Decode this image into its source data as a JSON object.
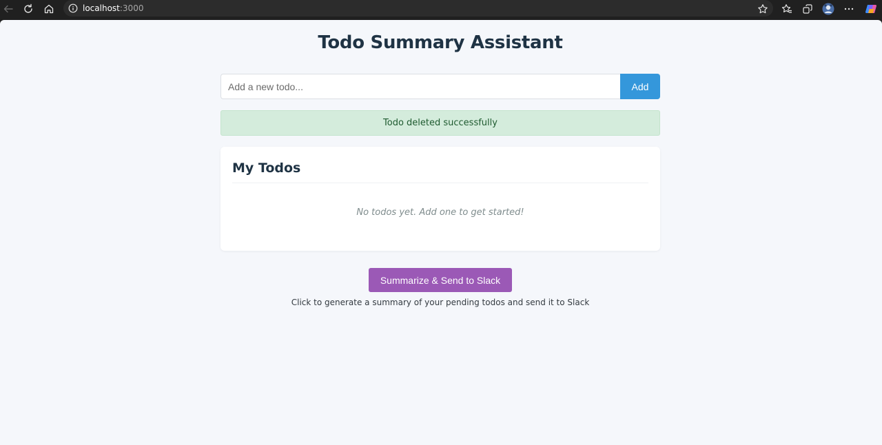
{
  "browser": {
    "url_host": "localhost",
    "url_port": ":3000",
    "icons": [
      "back-icon",
      "refresh-icon",
      "home-icon",
      "info-icon",
      "star-icon",
      "favorites-icon",
      "collections-icon",
      "profile-icon",
      "more-icon",
      "copilot-icon"
    ]
  },
  "page": {
    "title": "Todo Summary Assistant"
  },
  "new_todo": {
    "placeholder": "Add a new todo...",
    "value": "",
    "add_label": "Add"
  },
  "alert": {
    "message": "Todo deleted successfully"
  },
  "todos": {
    "heading": "My Todos",
    "empty_message": "No todos yet. Add one to get started!",
    "items": []
  },
  "summary": {
    "button_label": "Summarize & Send to Slack",
    "helper_text": "Click to generate a summary of your pending todos and send it to Slack"
  },
  "colors": {
    "primary": "#3497db",
    "accent": "#9b59b6",
    "success_bg": "#d4ecdc",
    "heading": "#1f3344",
    "page_bg": "#f5f7fb"
  }
}
